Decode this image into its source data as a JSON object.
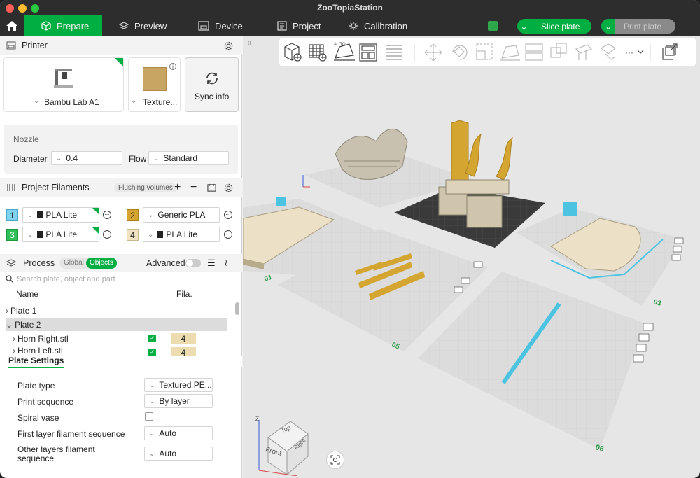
{
  "app_title": "ZooTopiaStation",
  "colors": {
    "accent": "#00ae42",
    "titlebar": "#2d2d2d",
    "gold": "#d4a531",
    "cyan": "#4cc3e0",
    "bed_grey": "#d8d8d8"
  },
  "tabs": [
    {
      "label": "Prepare",
      "icon": "cube-icon",
      "active": true
    },
    {
      "label": "Preview",
      "icon": "layers-icon",
      "active": false
    },
    {
      "label": "Device",
      "icon": "device-icon",
      "active": false
    },
    {
      "label": "Project",
      "icon": "project-icon",
      "active": false
    },
    {
      "label": "Calibration",
      "icon": "calibration-icon",
      "active": false
    }
  ],
  "actions": {
    "slice": "Slice plate",
    "print": "Print plate"
  },
  "printer": {
    "section_title": "Printer",
    "name": "Bambu Lab A1",
    "plate": "Texture...",
    "sync": "Sync info",
    "nozzle_title": "Nozzle",
    "diameter_label": "Diameter",
    "diameter_value": "0.4",
    "flow_label": "Flow",
    "flow_value": "Standard"
  },
  "filaments": {
    "section_title": "Project Filaments",
    "flushing": "Flushing volumes",
    "items": [
      {
        "num": "1",
        "name": "PLA Lite",
        "color": "#7fd3ef"
      },
      {
        "num": "2",
        "name": "Generic PLA",
        "color": "#d6a52f"
      },
      {
        "num": "3",
        "name": "PLA Lite",
        "color": "#2fbf57"
      },
      {
        "num": "4",
        "name": "PLA Lite",
        "color": "#efe2c0"
      }
    ]
  },
  "process": {
    "section_title": "Process",
    "toggle_global": "Global",
    "toggle_objects": "Objects",
    "advanced": "Advanced",
    "search_placeholder": "Search plate, object and part.",
    "col_name": "Name",
    "col_fila": "Fila.",
    "tree": [
      {
        "label": "Plate 1",
        "indent": 0,
        "selected": false
      },
      {
        "label": "Plate 2",
        "indent": 0,
        "selected": true
      },
      {
        "label": "Horn Right.stl",
        "indent": 1,
        "selected": false,
        "fila": "4"
      },
      {
        "label": "Horn Left.stl",
        "indent": 1,
        "selected": false,
        "fila": "4"
      }
    ]
  },
  "plate_settings": {
    "title": "Plate Settings",
    "rows": [
      {
        "label": "Plate type",
        "value": "Textured PE..."
      },
      {
        "label": "Print sequence",
        "value": "By layer"
      },
      {
        "label": "Spiral vase",
        "value": ""
      },
      {
        "label": "First layer filament sequence",
        "value": "Auto"
      },
      {
        "label": "Other layers filament sequence",
        "value": "Auto"
      }
    ]
  },
  "viewport": {
    "plate_labels": [
      "01",
      "02",
      "03",
      "05",
      "06"
    ],
    "nav_cube": {
      "top": "Top",
      "front": "Front",
      "right": "Right",
      "axis_z": "Z"
    }
  }
}
